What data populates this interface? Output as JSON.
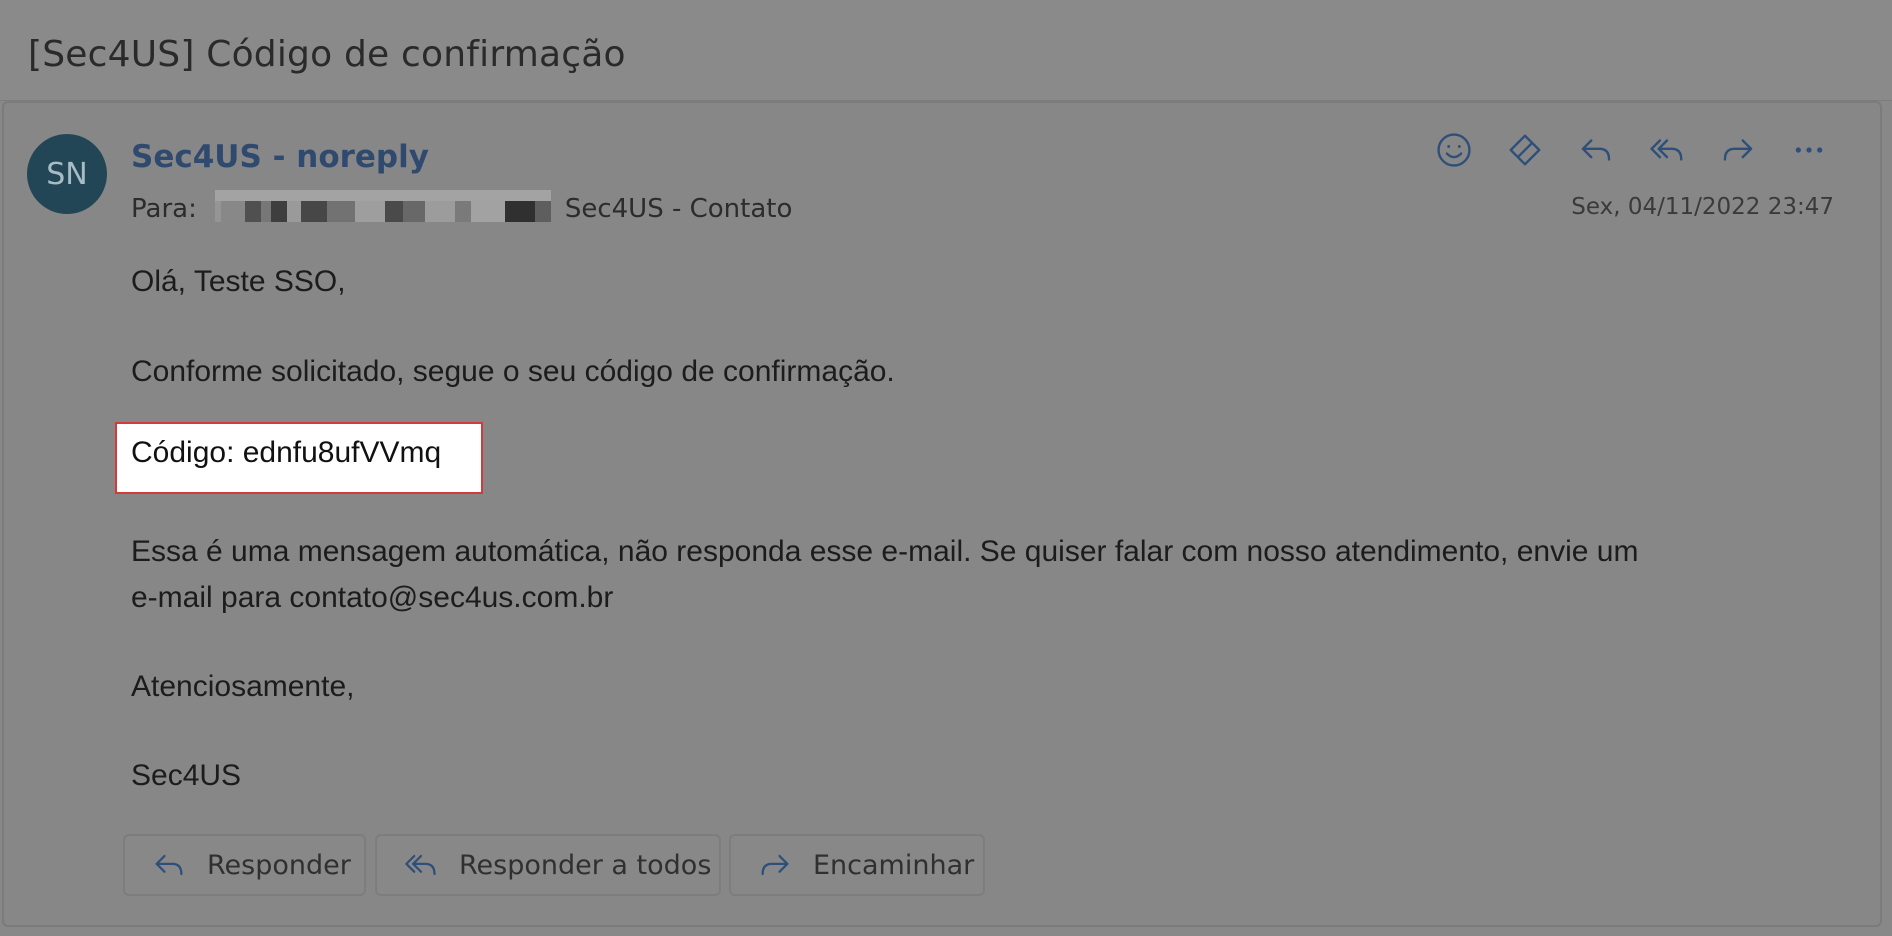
{
  "email": {
    "subject": "[Sec4US] Código de confirmação",
    "avatar_initials": "SN",
    "sender": "Sec4US - noreply",
    "to_label": "Para:",
    "to_recipient": "Sec4US - Contato",
    "datetime": "Sex, 04/11/2022 23:47",
    "body": {
      "greeting": "Olá, Teste SSO,",
      "intro": "Conforme solicitado, segue o seu código de confirmação.",
      "code_line": "Código: ednfu8ufVVmq",
      "notice_line1": "Essa é uma mensagem automática, não responda esse e-mail. Se quiser falar com nosso atendimento, envie um",
      "notice_line2": "e-mail para contato@sec4us.com.br",
      "closing": "Atenciosamente,",
      "signature": "Sec4US"
    }
  },
  "header_actions": [
    {
      "icon": "emoji-icon"
    },
    {
      "icon": "loop-icon"
    },
    {
      "icon": "reply-icon"
    },
    {
      "icon": "reply-all-icon"
    },
    {
      "icon": "forward-icon"
    },
    {
      "icon": "more-icon"
    }
  ],
  "footer_buttons": {
    "reply": "Responder",
    "reply_all": "Responder a todos",
    "forward": "Encaminhar"
  },
  "colors": {
    "sender_link": "#2f4a6e",
    "avatar_bg": "#234656",
    "icon_color": "#2e4f7a",
    "highlight_border": "#d33b3b"
  }
}
